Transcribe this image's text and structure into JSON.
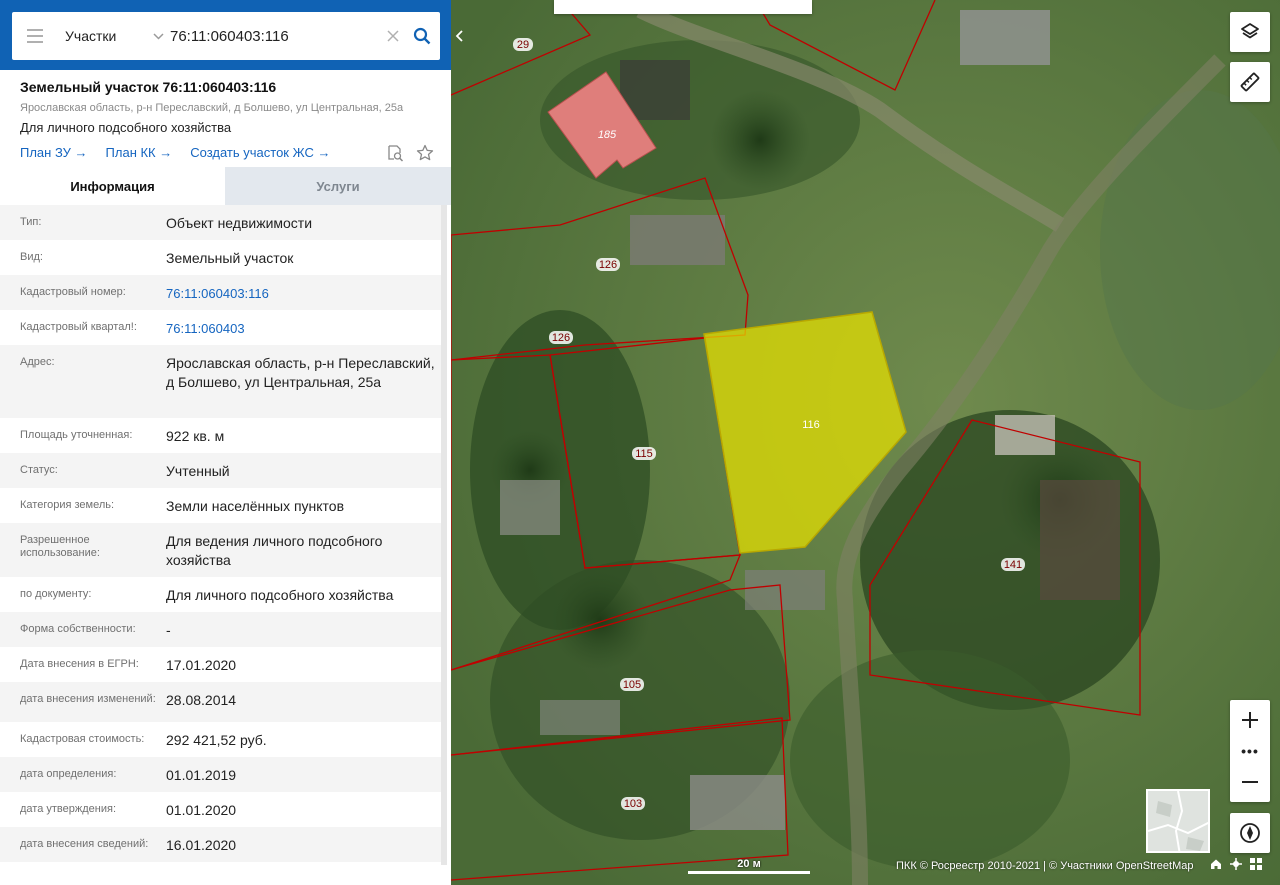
{
  "search": {
    "category": "Участки",
    "query": "76:11:060403:116"
  },
  "object": {
    "title": "Земельный участок 76:11:060403:116",
    "address": "Ярославская область, р-н Переславский, д Болшево, ул Центральная, 25а",
    "purpose": "Для личного подсобного хозяйства",
    "links": [
      "План ЗУ →",
      "План КК →",
      "Создать участок ЖС →"
    ]
  },
  "tabs": {
    "info": "Информация",
    "services": "Услуги"
  },
  "attributes": [
    {
      "key": "Тип:",
      "value": "Объект недвижимости"
    },
    {
      "key": "Вид:",
      "value": "Земельный участок"
    },
    {
      "key": "Кадастровый номер:",
      "value": "76:11:060403:116",
      "link": true
    },
    {
      "key": "Кадастровый квартал!:",
      "value": "76:11:060403",
      "link": true
    },
    {
      "key": "Адрес:",
      "value": "Ярославская область, р-н Переславский, д Болшево, ул Центральная, 25а"
    },
    {
      "key": "Площадь уточненная:",
      "value": "922 кв. м"
    },
    {
      "key": "Статус:",
      "value": "Учтенный"
    },
    {
      "key": "Категория земель:",
      "value": "Земли населённых пунктов"
    },
    {
      "key": "Разрешенное использование:",
      "value": "Для ведения личного подсобного хозяйства"
    },
    {
      "key": "по документу:",
      "value": "Для личного подсобного хозяйства"
    },
    {
      "key": "Форма собственности:",
      "value": "-"
    },
    {
      "key": "Дата внесения в ЕГРН:",
      "value": "17.01.2020"
    },
    {
      "key": "дата внесения изменений:",
      "value": "28.08.2014"
    },
    {
      "key": "Кадастровая стоимость:",
      "value": "292 421,52 руб."
    },
    {
      "key": "дата определения:",
      "value": "01.01.2019"
    },
    {
      "key": "дата утверждения:",
      "value": "01.01.2020"
    },
    {
      "key": "дата внесения сведений:",
      "value": "16.01.2020"
    }
  ],
  "map": {
    "plot_labels": [
      "29",
      "185",
      "126",
      "126",
      "116",
      "115",
      "141",
      "105",
      "103"
    ],
    "selected_plot": "116",
    "scale_label": "20 м",
    "attribution": "ПКК © Росреестр 2010-2021 | © Участники OpenStreetMap",
    "colors": {
      "selected_fill": "#e8e200",
      "boundary": "#c00000",
      "building_fill": "#e88080",
      "header": "#1062b4",
      "link": "#1565c0"
    }
  }
}
